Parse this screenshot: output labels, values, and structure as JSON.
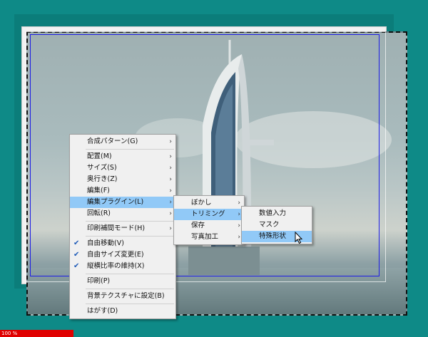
{
  "status": {
    "zoom_text": "100 %"
  },
  "context_menu": {
    "items": [
      {
        "label": "合成パターン(G)",
        "submenu": true
      },
      {
        "sep": true
      },
      {
        "label": "配置(M)",
        "submenu": true
      },
      {
        "label": "サイズ(S)",
        "submenu": true
      },
      {
        "label": "奥行き(Z)",
        "submenu": true
      },
      {
        "label": "編集(F)",
        "submenu": true
      },
      {
        "label": "編集プラグイン(L)",
        "submenu": true,
        "highlighted": true
      },
      {
        "label": "回転(R)",
        "submenu": true
      },
      {
        "sep": true
      },
      {
        "label": "印刷補間モード(H)",
        "submenu": true
      },
      {
        "sep": true
      },
      {
        "label": "自由移動(V)",
        "checked": true
      },
      {
        "label": "自由サイズ変更(E)",
        "checked": true
      },
      {
        "label": "縦横比率の維持(X)",
        "checked": true
      },
      {
        "sep": true
      },
      {
        "label": "印刷(P)"
      },
      {
        "sep": true
      },
      {
        "label": "背景テクスチャに設定(B)"
      },
      {
        "sep": true
      },
      {
        "label": "はがす(D)"
      }
    ]
  },
  "plugin_menu": {
    "items": [
      {
        "label": "ぼかし",
        "submenu": true
      },
      {
        "label": "トリミング",
        "submenu": true,
        "highlighted": true
      },
      {
        "label": "保存",
        "submenu": true
      },
      {
        "label": "写真加工",
        "submenu": true
      }
    ]
  },
  "trim_menu": {
    "items": [
      {
        "label": "数値入力"
      },
      {
        "label": "マスク"
      },
      {
        "label": "特殊形状",
        "highlighted": true
      }
    ]
  },
  "icons": {
    "check": "check-icon",
    "arrow": "chevron-right-icon",
    "cursor": "mouse-pointer-icon"
  },
  "colors": {
    "background": "#0e8a87",
    "highlight": "#91c9f7",
    "selection": "#1c1ce6",
    "status": "#e00000"
  }
}
